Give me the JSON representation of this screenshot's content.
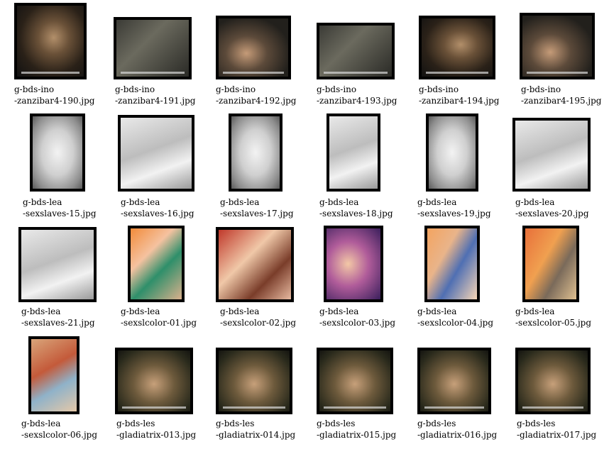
{
  "items": [
    {
      "line1": "g-bds-ino",
      "line2": "-zanzibar4-190.jpg"
    },
    {
      "line1": "g-bds-ino",
      "line2": "-zanzibar4-191.jpg"
    },
    {
      "line1": "g-bds-ino",
      "line2": "-zanzibar4-192.jpg"
    },
    {
      "line1": "g-bds-ino",
      "line2": "-zanzibar4-193.jpg"
    },
    {
      "line1": "g-bds-ino",
      "line2": "-zanzibar4-194.jpg"
    },
    {
      "line1": "g-bds-ino",
      "line2": "-zanzibar4-195.jpg"
    },
    {
      "line1": "g-bds-lea",
      "line2": "-sexslaves-15.jpg"
    },
    {
      "line1": "g-bds-lea",
      "line2": "-sexslaves-16.jpg"
    },
    {
      "line1": "g-bds-lea",
      "line2": "-sexslaves-17.jpg"
    },
    {
      "line1": "g-bds-lea",
      "line2": "-sexslaves-18.jpg"
    },
    {
      "line1": "g-bds-lea",
      "line2": "-sexslaves-19.jpg"
    },
    {
      "line1": "g-bds-lea",
      "line2": "-sexslaves-20.jpg"
    },
    {
      "line1": "g-bds-lea",
      "line2": "-sexslaves-21.jpg"
    },
    {
      "line1": "g-bds-lea",
      "line2": "-sexslcolor-01.jpg"
    },
    {
      "line1": "g-bds-lea",
      "line2": "-sexslcolor-02.jpg"
    },
    {
      "line1": "g-bds-lea",
      "line2": "-sexslcolor-03.jpg"
    },
    {
      "line1": "g-bds-lea",
      "line2": "-sexslcolor-04.jpg"
    },
    {
      "line1": "g-bds-lea",
      "line2": "-sexslcolor-05.jpg"
    },
    {
      "line1": "g-bds-lea",
      "line2": "-sexslcolor-06.jpg"
    },
    {
      "line1": "g-bds-les",
      "line2": "-gladiatrix-013.jpg"
    },
    {
      "line1": "g-bds-les",
      "line2": "-gladiatrix-014.jpg"
    },
    {
      "line1": "g-bds-les",
      "line2": "-gladiatrix-015.jpg"
    },
    {
      "line1": "g-bds-les",
      "line2": "-gladiatrix-016.jpg"
    },
    {
      "line1": "g-bds-les",
      "line2": "-gladiatrix-017.jpg"
    }
  ]
}
